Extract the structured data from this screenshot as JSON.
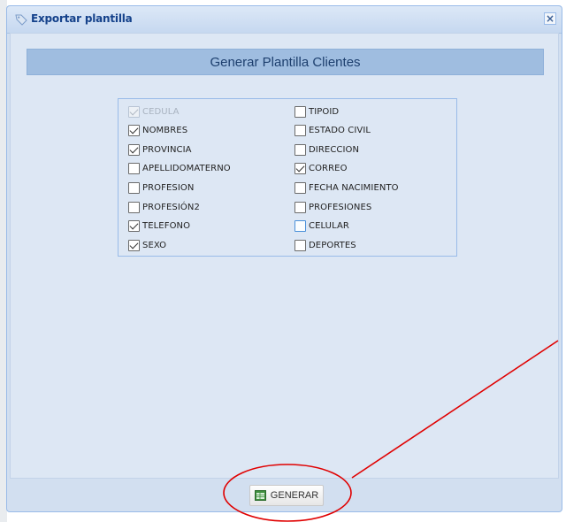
{
  "window": {
    "title": "Exportar plantilla",
    "close_symbol": "×",
    "title_icon": "tag-icon"
  },
  "panel": {
    "header": "Generar Plantilla Clientes"
  },
  "fields_left": [
    {
      "label": "CEDULA",
      "checked": true,
      "disabled": true
    },
    {
      "label": "NOMBRES",
      "checked": true
    },
    {
      "label": "PROVINCIA",
      "checked": true
    },
    {
      "label": "APELLIDOMATERNO",
      "checked": false
    },
    {
      "label": "PROFESION",
      "checked": false
    },
    {
      "label": "PROFESIÓN2",
      "checked": false
    },
    {
      "label": "TELEFONO",
      "checked": true
    },
    {
      "label": "SEXO",
      "checked": true
    }
  ],
  "fields_right": [
    {
      "label": "TIPOID",
      "checked": false
    },
    {
      "label": "ESTADO CIVIL",
      "checked": false
    },
    {
      "label": "DIRECCION",
      "checked": false
    },
    {
      "label": "CORREO",
      "checked": true
    },
    {
      "label": "FECHA NACIMIENTO",
      "checked": false
    },
    {
      "label": "PROFESIONES",
      "checked": false
    },
    {
      "label": "CELULAR",
      "checked": false,
      "hover": true
    },
    {
      "label": "DEPORTES",
      "checked": false
    }
  ],
  "footer": {
    "generate_label": "GENERAR",
    "generate_icon": "spreadsheet-icon"
  },
  "colors": {
    "annotation": "#e00000",
    "dialog_bg": "#d2dff0",
    "header_bar": "#9fbde0"
  }
}
